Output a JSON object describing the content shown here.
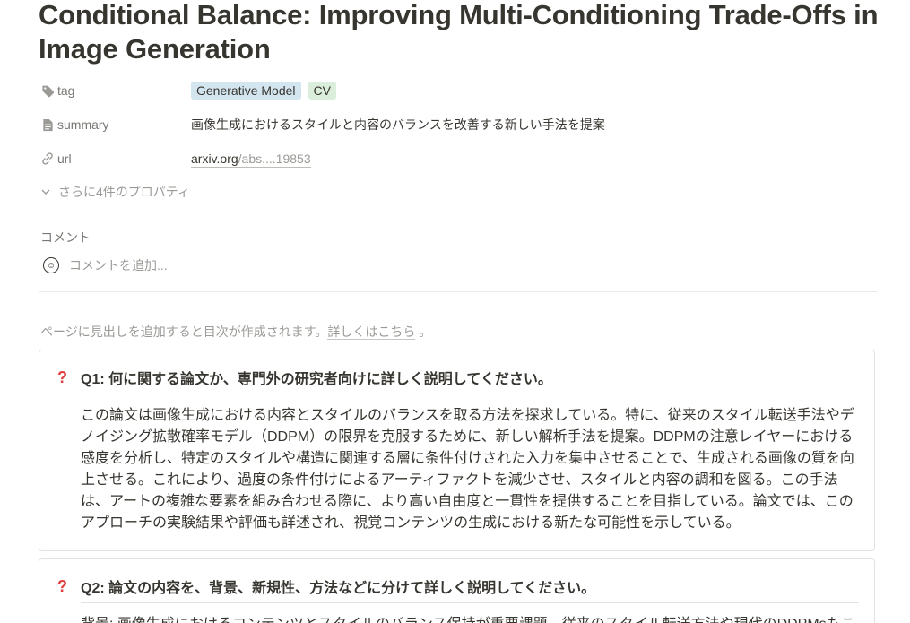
{
  "page": {
    "title": "Conditional Balance: Improving Multi-Conditioning Trade-Offs in Image Generation"
  },
  "properties": [
    {
      "name": "tag",
      "icon": "tag-icon"
    },
    {
      "name": "summary",
      "icon": "text-lines-icon"
    },
    {
      "name": "url",
      "icon": "link-icon"
    }
  ],
  "tags": [
    {
      "label": "Generative Model",
      "color": "#d3e5ef"
    },
    {
      "label": "CV",
      "color": "#dbeddb"
    }
  ],
  "summary_value": "画像生成におけるスタイルと内容のバランスを改善する新しい手法を提案",
  "url_value": {
    "domain": "arxiv.org",
    "rest": "/abs....19853"
  },
  "more_properties": "さらに4件のプロパティ",
  "comments": {
    "label": "コメント",
    "placeholder": "コメントを追加..."
  },
  "toc_hint": {
    "text": "ページに見出しを追加すると目次が作成されます。",
    "link": "詳しくはこちら",
    "end": "。"
  },
  "qa": [
    {
      "icon": "question-icon",
      "question": "Q1: 何に関する論文か、専門外の研究者向けに詳しく説明してください。",
      "answer_lines": [
        "この論文は画像生成における内容とスタイルのバランスを取る方法を探求している。特に、従来のスタイル転送手法やデ",
        "ノイジング拡散確率モデル（DDPM）の限界を克服するために、新しい解析手法を提案。DDPMの注意レイヤーにおける",
        "感度を分析し、特定のスタイルや構造に関連する層に条件付けされた入力を集中させることで、生成される画像の質を向",
        "上させる。これにより、過度の条件付けによるアーティファクトを減少させ、スタイルと内容の調和を図る。この手法",
        "は、アートの複雑な要素を組み合わせる際に、より高い自由度と一貫性を提供することを目指している。論文では、この",
        "アプローチの実験結果や評価も詳述され、視覚コンテンツの生成における新たな可能性を示している。"
      ]
    },
    {
      "icon": "question-icon",
      "question": "Q2: 論文の内容を、背景、新規性、方法などに分けて詳しく説明してください。",
      "answer_lines": [
        "背景: 画像生成におけるコンテンツとスタイルのバランス保持が重要課題。従来のスタイル転送方法や現代のDDPMsもこ"
      ]
    }
  ],
  "colors": {
    "question_mark": "#e03e3e",
    "text": "#37352f",
    "muted": "#9b9a97"
  }
}
